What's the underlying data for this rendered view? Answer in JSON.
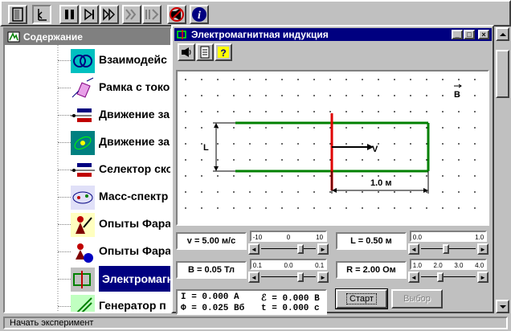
{
  "toolbar": {
    "buttons": [
      {
        "name": "door-icon"
      },
      {
        "name": "back-icon"
      },
      {
        "name": "pause-icon"
      },
      {
        "name": "step-forward-icon"
      },
      {
        "name": "fast-forward-icon"
      },
      {
        "name": "next-frame-icon"
      },
      {
        "name": "step-list-icon"
      },
      {
        "name": "sound-off-icon"
      },
      {
        "name": "info-icon"
      }
    ]
  },
  "toc": {
    "header": "Содержание",
    "items": [
      {
        "label": "Взаимодейс",
        "icon": "interaction-icon"
      },
      {
        "label": "Рамка с токо",
        "icon": "current-frame-icon"
      },
      {
        "label": "Движение за",
        "icon": "charge-motion-icon"
      },
      {
        "label": "Движение за",
        "icon": "orbit-icon"
      },
      {
        "label": "Селектор ско",
        "icon": "velocity-selector-icon"
      },
      {
        "label": "Масс-спектр",
        "icon": "mass-spectrometer-icon"
      },
      {
        "label": "Опыты Фара",
        "icon": "faraday-experiment-icon"
      },
      {
        "label": "Опыты Фара",
        "icon": "faraday-experiment-2-icon"
      },
      {
        "label": "Электромагн",
        "icon": "induction-icon",
        "selected": true
      },
      {
        "label": "Генератор п",
        "icon": "generator-icon"
      }
    ]
  },
  "window": {
    "title": "Электромагнитная индукция",
    "minimize": "_",
    "maximize": "□",
    "close": "×"
  },
  "canvas": {
    "b_label": "B",
    "l_label": "L",
    "v_label": "V",
    "dist_label": "1.0 м"
  },
  "params": {
    "v": "v = 5.00 м/с",
    "B": "B = 0.05 Тл",
    "L": "L = 0.50 м",
    "R": "R = 2.00 Ом"
  },
  "sliders": {
    "v": {
      "ticks": [
        "-10",
        "0",
        "10"
      ],
      "level": 0.75
    },
    "B": {
      "ticks": [
        "0.1",
        "0.0",
        "0.1"
      ],
      "level": 0.75
    },
    "L": {
      "ticks": [
        "0.0",
        "1.0"
      ],
      "level": 0.45
    },
    "R": {
      "ticks": [
        "1.0",
        "2.0",
        "3.0",
        "4.0"
      ],
      "level": 0.33
    }
  },
  "readout": {
    "I": "I  = 0.000 A",
    "E": "ℰ  = 0.000 В",
    "Phi": "Φ  = 0.025 Вб",
    "t": "t  = 0.000 с"
  },
  "buttons": {
    "start": "Старт",
    "select": "Выбор"
  },
  "status": "Начать эксперимент"
}
